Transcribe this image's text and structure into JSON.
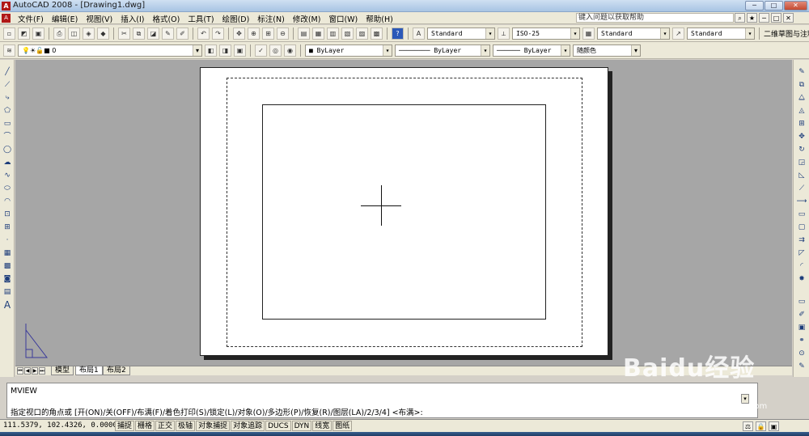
{
  "window": {
    "title": "AutoCAD 2008 - [Drawing1.dwg]",
    "app_icon": "A",
    "min": "─",
    "max": "□",
    "close": "✕",
    "doc_min": "─",
    "doc_max": "□",
    "doc_close": "✕"
  },
  "menubar": {
    "items": [
      "文件(F)",
      "编辑(E)",
      "视图(V)",
      "插入(I)",
      "格式(O)",
      "工具(T)",
      "绘图(D)",
      "标注(N)",
      "修改(M)",
      "窗口(W)",
      "帮助(H)"
    ],
    "help_placeholder": "键入问题以获取帮助"
  },
  "toolbar1": {
    "text_style": "Standard",
    "dim_style": "ISO-25",
    "table_style": "Standard",
    "mleader_style": "Standard",
    "workspace": "二维草图与注释"
  },
  "toolbar2": {
    "layer": "0",
    "color": "ByLayer",
    "linetype": "ByLayer",
    "lineweight": "ByLayer",
    "plot_style": "随颜色"
  },
  "layout_tabs": [
    "模型",
    "布局1",
    "布局2"
  ],
  "active_tab": "布局1",
  "command": {
    "line1": "MVIEW",
    "line2": "指定视口的角点或 [开(ON)/关(OFF)/布满(F)/着色打印(S)/锁定(L)/对象(O)/多边形(P)/恢复(R)/图层(LA)/2/3/4] <布满>:"
  },
  "status": {
    "coords": "111.5379, 102.4326, 0.0000",
    "toggles": [
      "捕捉",
      "栅格",
      "正交",
      "极轴",
      "对象捕捉",
      "对象追踪",
      "DUCS",
      "DYN",
      "线宽",
      "图纸"
    ]
  },
  "watermark": {
    "text": "Baidu经验",
    "url": "jingyan.baidu.com"
  },
  "colors": {
    "canvas": "#a6a6a6",
    "paper": "#ffffff",
    "toolbar": "#ece9d8",
    "titlebar": "#a8c4e3"
  }
}
